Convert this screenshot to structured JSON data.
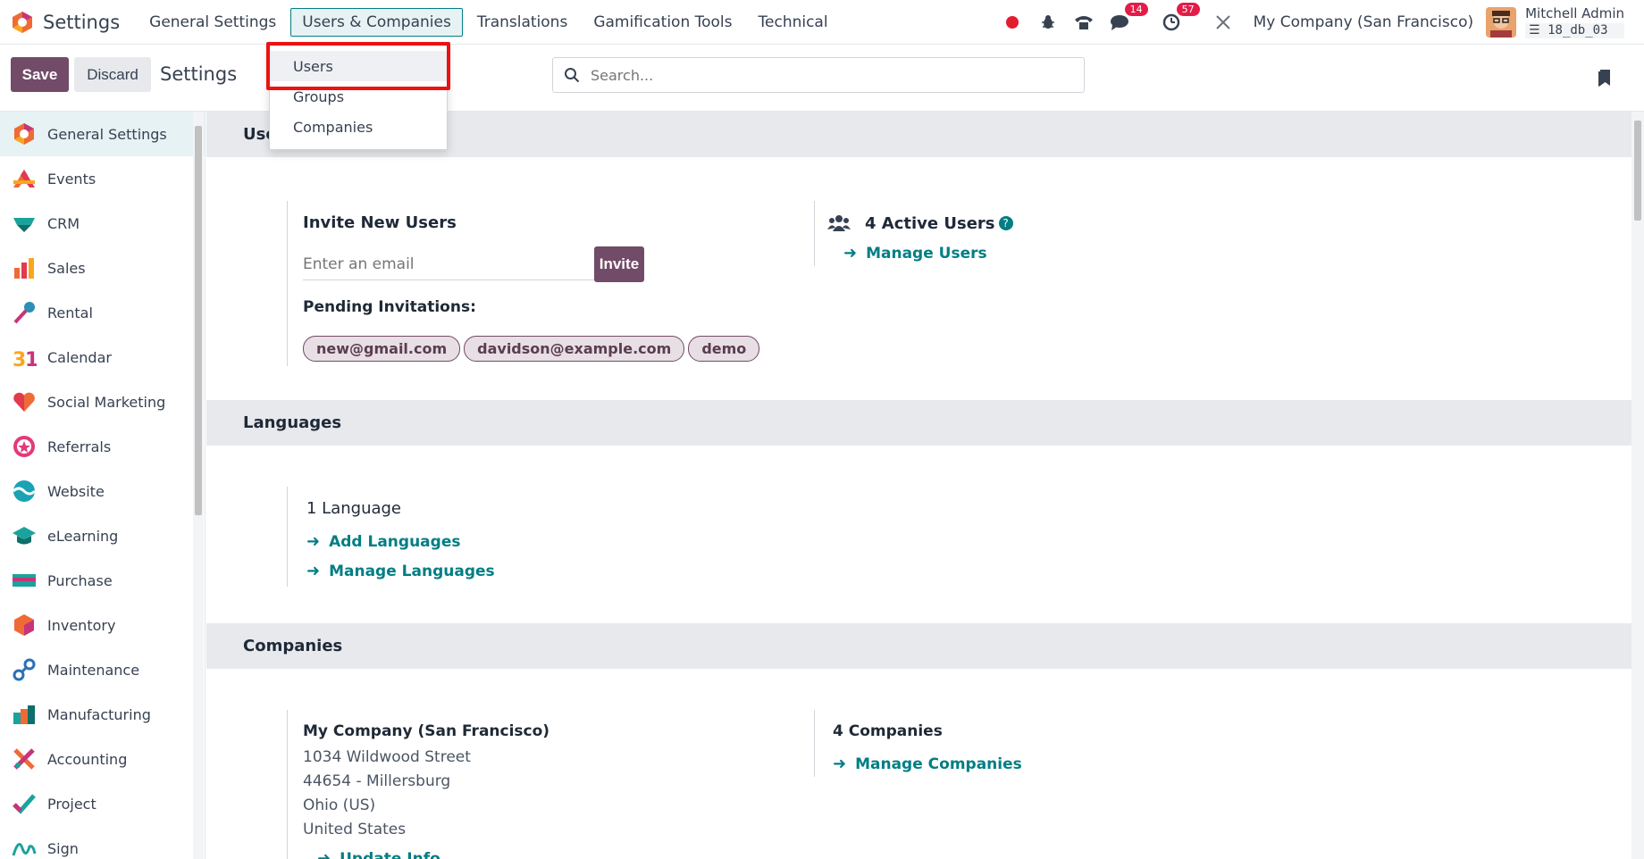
{
  "app": {
    "title": "Settings",
    "menus": [
      "General Settings",
      "Users & Companies",
      "Translations",
      "Gamification Tools",
      "Technical"
    ],
    "active_menu": "Users & Companies"
  },
  "systray": {
    "messages_count": "14",
    "activities_count": "57",
    "company": "My Company (San Francisco)",
    "user_name": "Mitchell Admin",
    "db_name": "18_db_03"
  },
  "control": {
    "save_label": "Save",
    "discard_label": "Discard",
    "breadcrumb": "Settings",
    "search_placeholder": "Search..."
  },
  "dropdown": {
    "items": [
      "Users",
      "Groups",
      "Companies"
    ]
  },
  "sidebar": {
    "items": [
      {
        "label": "General Settings",
        "icon": "odoo-settings-icon"
      },
      {
        "label": "Events",
        "icon": "events-icon"
      },
      {
        "label": "CRM",
        "icon": "crm-icon"
      },
      {
        "label": "Sales",
        "icon": "sales-icon"
      },
      {
        "label": "Rental",
        "icon": "rental-icon"
      },
      {
        "label": "Calendar",
        "icon": "calendar-icon"
      },
      {
        "label": "Social Marketing",
        "icon": "social-marketing-icon"
      },
      {
        "label": "Referrals",
        "icon": "referrals-icon"
      },
      {
        "label": "Website",
        "icon": "website-icon"
      },
      {
        "label": "eLearning",
        "icon": "elearning-icon"
      },
      {
        "label": "Purchase",
        "icon": "purchase-icon"
      },
      {
        "label": "Inventory",
        "icon": "inventory-icon"
      },
      {
        "label": "Maintenance",
        "icon": "maintenance-icon"
      },
      {
        "label": "Manufacturing",
        "icon": "manufacturing-icon"
      },
      {
        "label": "Accounting",
        "icon": "accounting-icon"
      },
      {
        "label": "Project",
        "icon": "project-icon"
      },
      {
        "label": "Sign",
        "icon": "sign-icon"
      }
    ]
  },
  "users_section": {
    "header": "Users",
    "invite_title": "Invite New Users",
    "email_placeholder": "Enter an email",
    "invite_button": "Invite",
    "pending_title": "Pending Invitations:",
    "pending": [
      "new@gmail.com",
      "davidson@example.com",
      "demo"
    ],
    "active_users": "4 Active Users",
    "manage_users": "Manage Users"
  },
  "languages_section": {
    "header": "Languages",
    "count": "1 Language",
    "add_languages": "Add Languages",
    "manage_languages": "Manage Languages"
  },
  "companies_section": {
    "header": "Companies",
    "company_name": "My Company (San Francisco)",
    "address": [
      "1034 Wildwood Street",
      "44654 - Millersburg",
      "Ohio (US)",
      "United States"
    ],
    "update_info": "Update Info",
    "companies_count": "4 Companies",
    "manage_companies": "Manage Companies"
  },
  "colors": {
    "brand": "#714b67",
    "accent": "#017e84",
    "highlight": "#ee1111"
  }
}
